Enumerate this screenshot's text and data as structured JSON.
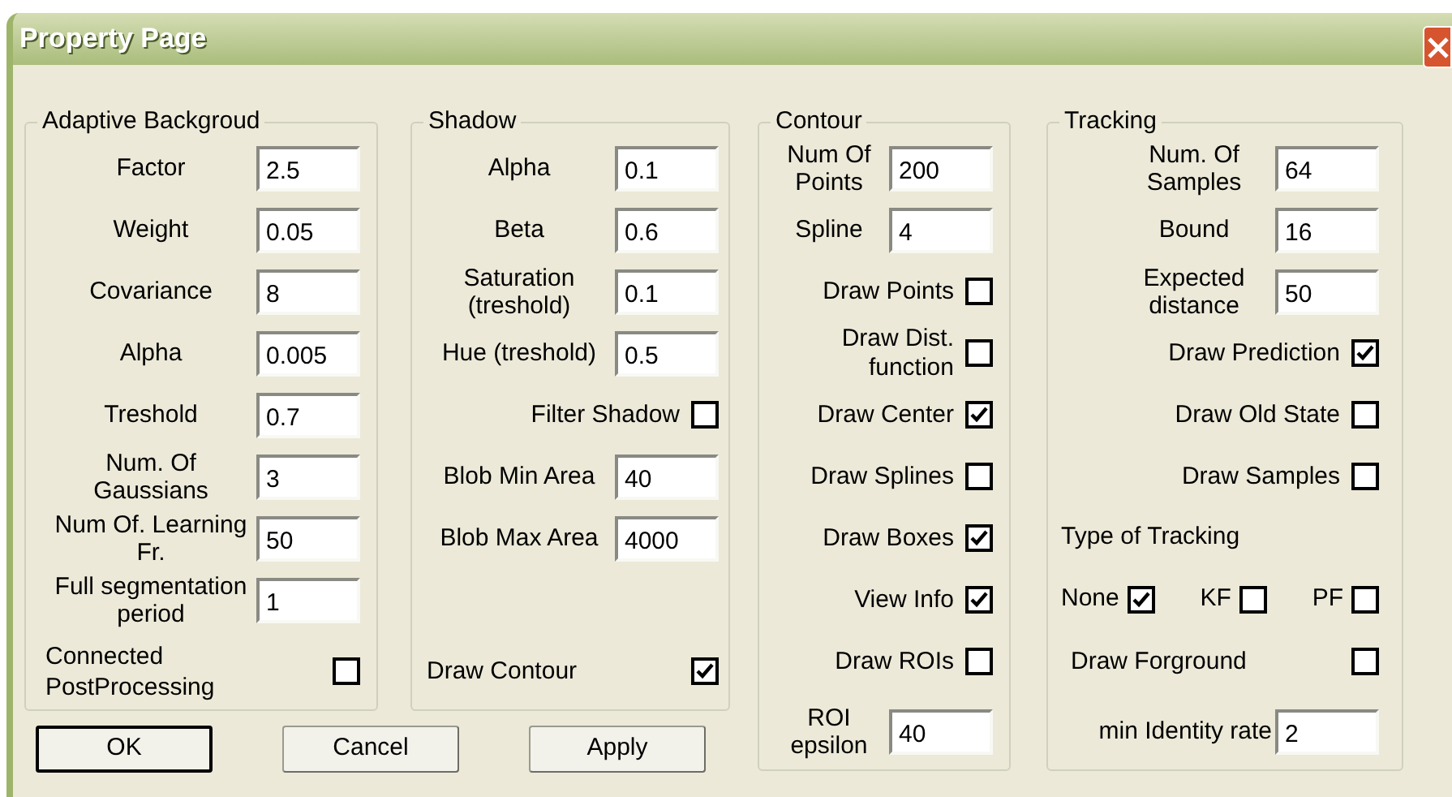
{
  "window": {
    "title": "Property Page"
  },
  "groups": [
    {
      "title": "Adaptive Backgroud",
      "rows": [
        {
          "kind": "field",
          "label": "Factor",
          "value": "2.5"
        },
        {
          "kind": "field",
          "label": "Weight",
          "value": "0.05"
        },
        {
          "kind": "field",
          "label": "Covariance",
          "value": "8"
        },
        {
          "kind": "field",
          "label": "Alpha",
          "value": "0.005"
        },
        {
          "kind": "field",
          "label": "Treshold",
          "value": "0.7"
        },
        {
          "kind": "field",
          "label": "Num. Of Gaussians",
          "value": "3"
        },
        {
          "kind": "field",
          "label": "Num Of. Learning Fr.",
          "value": "50"
        },
        {
          "kind": "field",
          "label": "Full segmentation period",
          "value": "1"
        },
        {
          "kind": "check_spread",
          "label": "Connected PostProcessing",
          "checked": false
        }
      ]
    },
    {
      "title": "Shadow",
      "rows": [
        {
          "kind": "field",
          "label": "Alpha",
          "value": "0.1"
        },
        {
          "kind": "field",
          "label": "Beta",
          "value": "0.6"
        },
        {
          "kind": "field",
          "label": "Saturation (treshold)",
          "value": "0.1"
        },
        {
          "kind": "field",
          "label": "Hue (treshold)",
          "value": "0.5"
        },
        {
          "kind": "check",
          "label": "Filter Shadow",
          "checked": false
        },
        {
          "kind": "field",
          "label": "Blob Min Area",
          "value": "40"
        },
        {
          "kind": "field",
          "label": "Blob Max Area",
          "value": "4000"
        },
        {
          "kind": "check_spread",
          "label": "Draw Contour",
          "checked": true
        }
      ]
    },
    {
      "title": "Contour",
      "rows": [
        {
          "kind": "field",
          "label": "Num Of Points",
          "value": "200"
        },
        {
          "kind": "field",
          "label": "Spline",
          "value": "4"
        },
        {
          "kind": "check",
          "label": "Draw Points",
          "checked": false
        },
        {
          "kind": "check",
          "label": "Draw Dist. function",
          "checked": false
        },
        {
          "kind": "check",
          "label": "Draw Center",
          "checked": true
        },
        {
          "kind": "check",
          "label": "Draw Splines",
          "checked": false
        },
        {
          "kind": "check",
          "label": "Draw Boxes",
          "checked": true
        },
        {
          "kind": "check",
          "label": "View Info",
          "checked": true
        },
        {
          "kind": "check",
          "label": "Draw ROIs",
          "checked": false
        },
        {
          "kind": "field",
          "label": "ROI epsilon",
          "value": "40"
        }
      ]
    },
    {
      "title": "Tracking",
      "rows": [
        {
          "kind": "field",
          "label": "Num. Of Samples",
          "value": "64"
        },
        {
          "kind": "field",
          "label": "Bound",
          "value": "16"
        },
        {
          "kind": "field",
          "label": "Expected distance",
          "value": "50"
        },
        {
          "kind": "check",
          "label": "Draw Prediction",
          "checked": true
        },
        {
          "kind": "check",
          "label": "Draw Old State",
          "checked": false
        },
        {
          "kind": "check",
          "label": "Draw Samples",
          "checked": false
        },
        {
          "kind": "heading",
          "label": "Type of Tracking"
        },
        {
          "kind": "options",
          "options": [
            {
              "label": "None",
              "checked": true
            },
            {
              "label": "KF",
              "checked": false
            },
            {
              "label": "PF",
              "checked": false
            }
          ]
        },
        {
          "kind": "check_spread",
          "label": "Draw Forground",
          "checked": false
        },
        {
          "kind": "field_wide",
          "label": "min Identity rate",
          "value": "2"
        }
      ]
    }
  ],
  "buttons": [
    {
      "label": "OK",
      "default": true
    },
    {
      "label": "Cancel",
      "default": false
    },
    {
      "label": "Apply",
      "default": false
    }
  ]
}
